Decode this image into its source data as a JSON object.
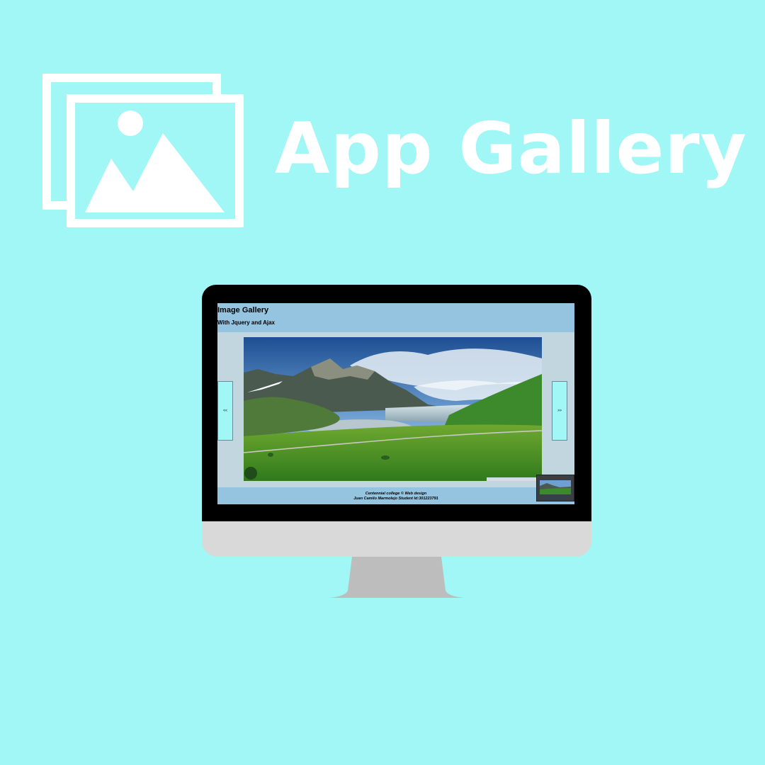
{
  "header": {
    "title": "App Gallery",
    "logo_icon": "photo-gallery-icon"
  },
  "screen": {
    "title": "Image Gallery",
    "subtitle": "With Jquery and Ajax",
    "prev_label": "<<",
    "next_label": ">>",
    "footer": {
      "line1": "Centennial college © Web design",
      "line2": "Juan Camilo Marmolejo Student Id:301223791"
    },
    "main_image": "mountain-lake-landscape"
  },
  "colors": {
    "background": "#a1f7f6",
    "header_bar": "#94c4df",
    "screen_body": "#c2d6e0",
    "monitor_bezel": "#000000",
    "monitor_chin": "#d9d9d9",
    "monitor_stand": "#bdbdbd"
  }
}
